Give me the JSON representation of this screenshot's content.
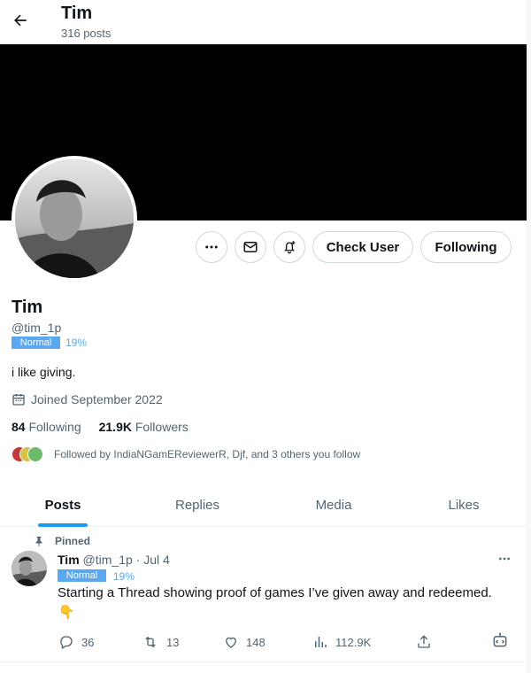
{
  "header": {
    "title": "Tim",
    "post_count": "316 posts"
  },
  "profile": {
    "name": "Tim",
    "handle": "@tim_1p",
    "badge": "Normal",
    "badge_percent": "19%",
    "bio": "i like giving.",
    "joined": "Joined September 2022",
    "following_count": "84",
    "following_label": "Following",
    "followers_count": "21.9K",
    "followers_label": "Followers",
    "followed_by": "Followed by IndiaNGamEReviewerR, Djf, and 3 others you follow"
  },
  "actions": {
    "more_icon": "more-icon",
    "message_icon": "mail-icon",
    "notify_icon": "bell-plus-icon",
    "check_user_label": "Check User",
    "following_button_label": "Following"
  },
  "tabs": [
    {
      "label": "Posts",
      "active": true
    },
    {
      "label": "Replies",
      "active": false
    },
    {
      "label": "Media",
      "active": false
    },
    {
      "label": "Likes",
      "active": false
    }
  ],
  "post": {
    "pinned_label": "Pinned",
    "author": "Tim",
    "handle_date": "@tim_1p · Jul 4",
    "badge": "Normal",
    "badge_percent": "19%",
    "text": "Starting a Thread showing proof of games I’ve given away and redeemed.",
    "emoji": "👇",
    "replies": "36",
    "reposts": "13",
    "likes": "148",
    "views": "112.9K"
  },
  "colors": {
    "accent": "#1d9bf0",
    "badge": "#5ba7f0",
    "text_secondary": "#536471",
    "border": "#cfd9de"
  }
}
